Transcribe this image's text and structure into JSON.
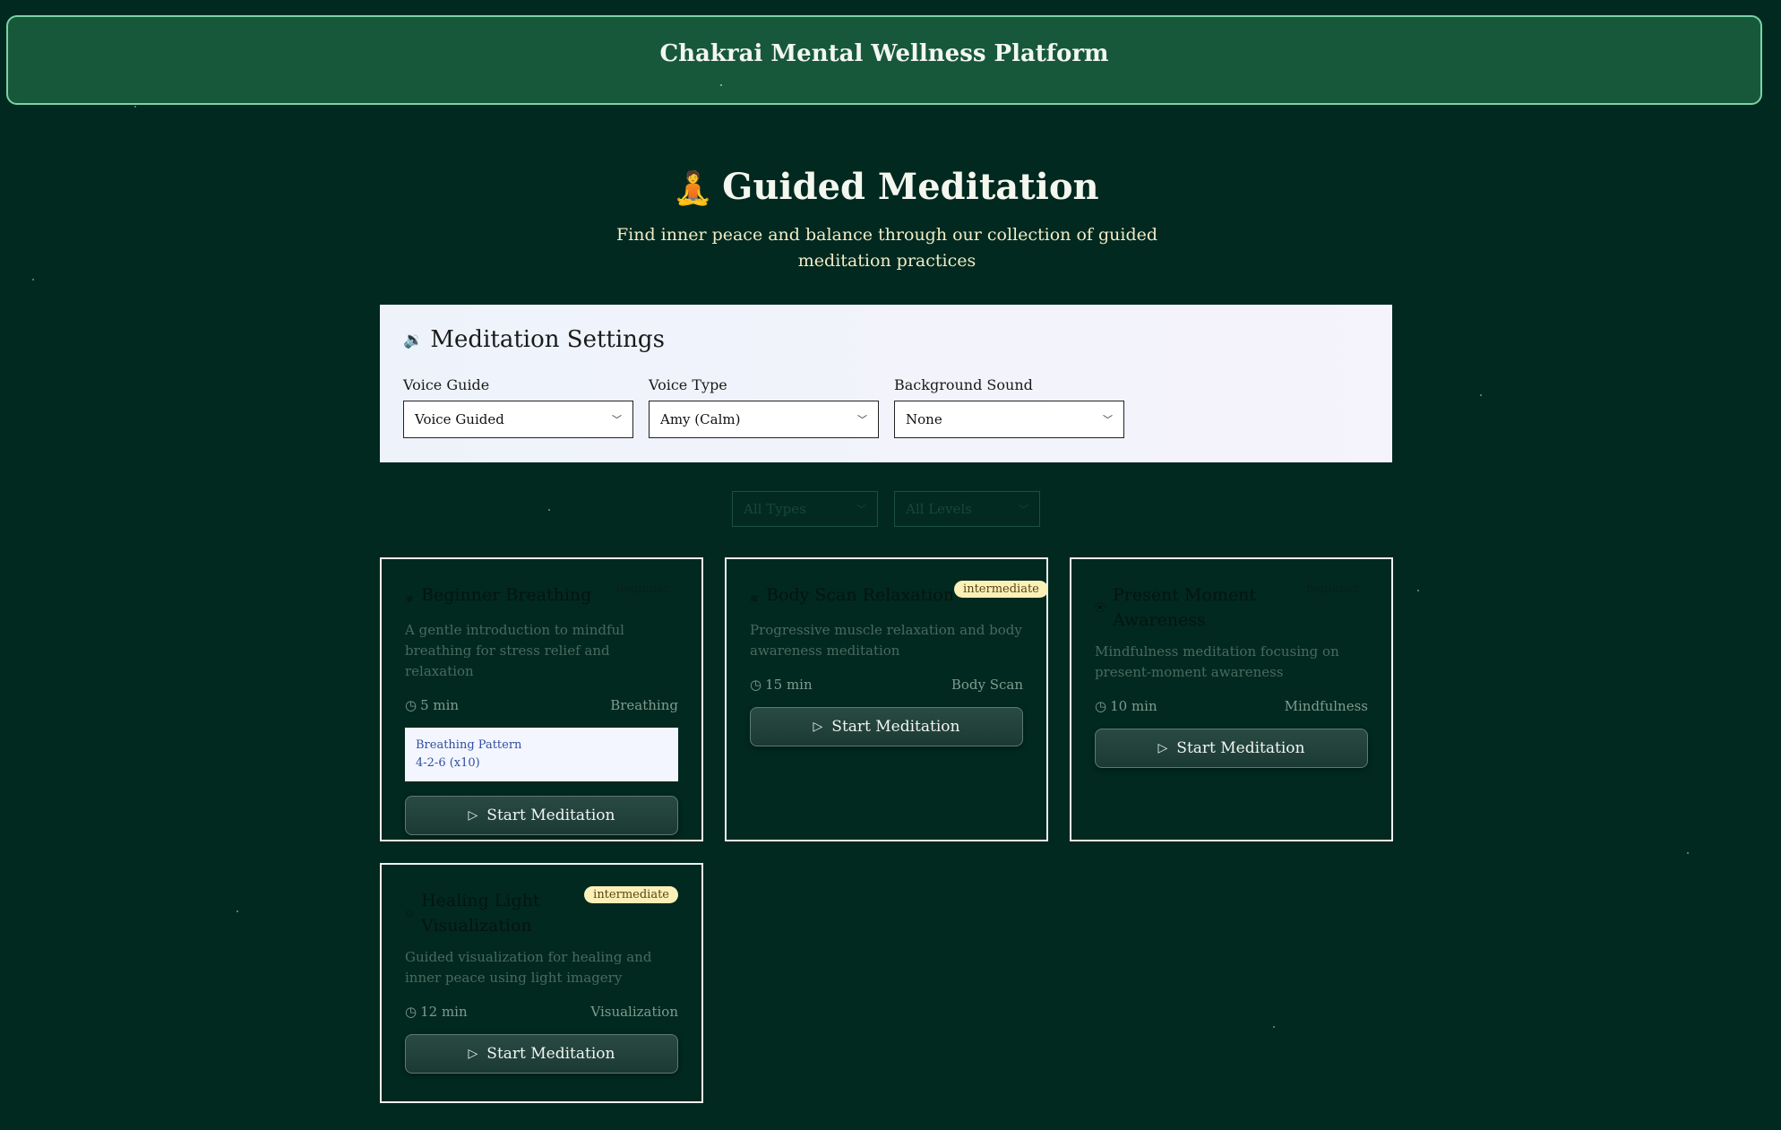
{
  "app": {
    "title": "Chakrai Mental Wellness Platform"
  },
  "hero": {
    "emoji": "🧘",
    "title": "Guided Meditation",
    "subtitle": "Find inner peace and balance through our collection of guided meditation practices"
  },
  "settings": {
    "icon": "🔉",
    "title": "Meditation Settings",
    "fields": [
      {
        "label": "Voice Guide",
        "value": "Voice Guided"
      },
      {
        "label": "Voice Type",
        "value": "Amy (Calm)"
      },
      {
        "label": "Background Sound",
        "value": "None"
      }
    ]
  },
  "filters": {
    "type": "All Types",
    "level": "All Levels"
  },
  "cards": [
    {
      "icon": "≉",
      "title": "Beginner Breathing",
      "level": "beginner",
      "description": "A gentle introduction to mindful breathing for stress relief and relaxation",
      "duration": "5 min",
      "category": "Breathing",
      "pattern_label": "Breathing Pattern",
      "pattern_value": "4-2-6 (x10)",
      "button": "Start Meditation"
    },
    {
      "icon": "≋",
      "title": "Body Scan Relaxation",
      "level": "intermediate",
      "description": "Progressive muscle relaxation and body awareness meditation",
      "duration": "15 min",
      "category": "Body Scan",
      "button": "Start Meditation"
    },
    {
      "icon": "⦿",
      "title": "Present Moment Awareness",
      "level": "beginner",
      "description": "Mindfulness meditation focusing on present-moment awareness",
      "duration": "10 min",
      "category": "Mindfulness",
      "button": "Start Meditation"
    },
    {
      "icon": "✩",
      "title": "Healing Light Visualization",
      "level": "intermediate",
      "description": "Guided visualization for healing and inner peace using light imagery",
      "duration": "12 min",
      "category": "Visualization",
      "button": "Start Meditation"
    }
  ],
  "colors": {
    "background": "#01291f",
    "banner": "#18583a",
    "banner_border": "#7ad3a8",
    "intermediate_badge": "#fbf0b8"
  }
}
